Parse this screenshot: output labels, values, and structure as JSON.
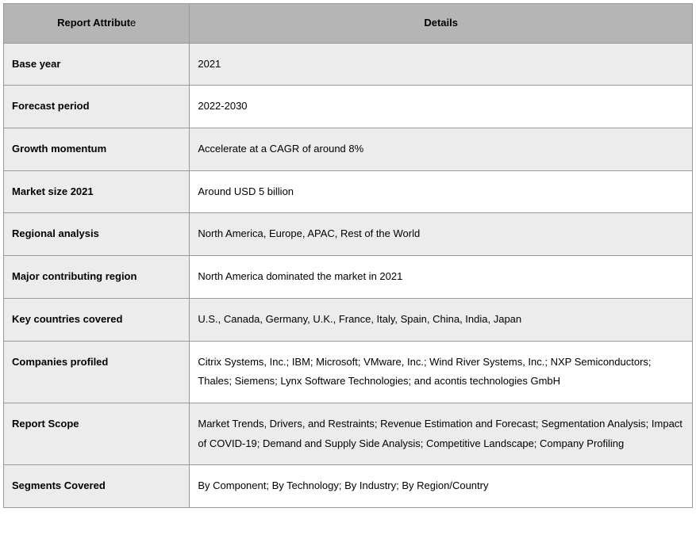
{
  "table": {
    "header": {
      "col1_bold": "Report Attribut",
      "col1_trail": "e",
      "col2": "Details"
    },
    "rows": [
      {
        "attr": "Base year",
        "detail": "2021"
      },
      {
        "attr": "Forecast period",
        "detail": "2022-2030"
      },
      {
        "attr": "Growth momentum",
        "detail": "Accelerate at a CAGR of around 8%"
      },
      {
        "attr": "Market size 2021",
        "detail": "Around USD 5 billion"
      },
      {
        "attr": "Regional analysis",
        "detail": "North America, Europe, APAC, Rest of the World"
      },
      {
        "attr": "Major contributing region",
        "detail": "North America dominated the market in 2021"
      },
      {
        "attr": "Key countries covered",
        "detail": "U.S., Canada, Germany, U.K., France, Italy, Spain, China, India, Japan"
      },
      {
        "attr": "Companies profiled",
        "detail": "Citrix Systems, Inc.; IBM; Microsoft; VMware, Inc.; Wind River Systems, Inc.; NXP Semiconductors; Thales; Siemens; Lynx Software Technologies; and acontis technologies GmbH"
      },
      {
        "attr": "Report Scope",
        "detail": "Market Trends, Drivers, and Restraints; Revenue Estimation and Forecast; Segmentation Analysis; Impact of COVID-19; Demand and Supply Side Analysis; Competitive Landscape; Company Profiling"
      },
      {
        "attr": "Segments Covered",
        "detail": "By Component; By Technology; By Industry; By Region/Country"
      }
    ]
  }
}
